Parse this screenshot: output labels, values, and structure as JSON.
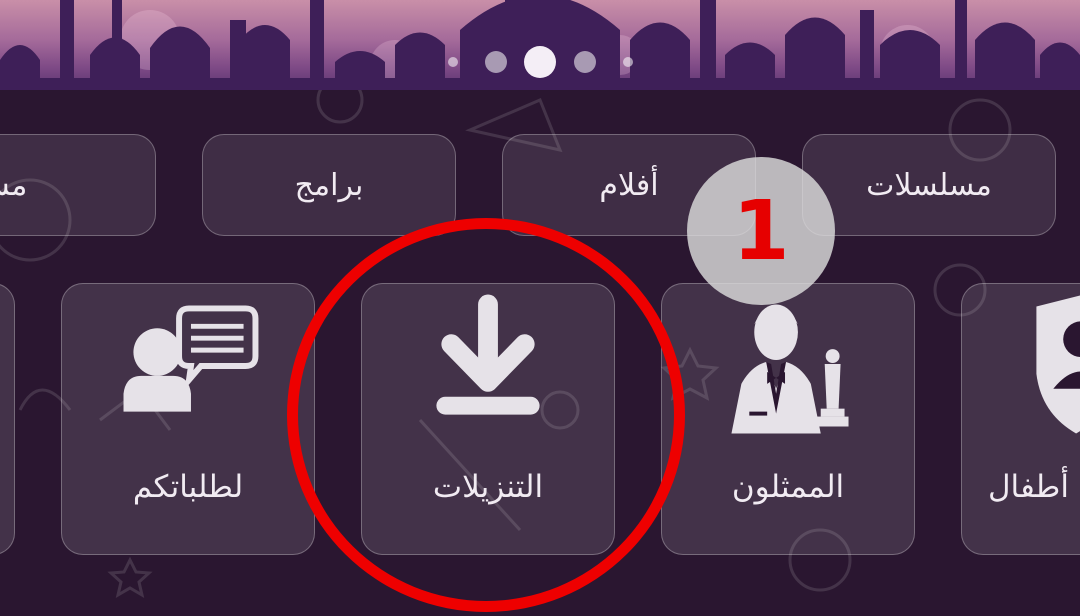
{
  "banner": {
    "carousel": {
      "count": 5,
      "active_index": 2
    }
  },
  "categories": [
    {
      "label": "مسلسلات"
    },
    {
      "label": "أفلام"
    },
    {
      "label": "برامج"
    },
    {
      "label": "مسرحيات"
    }
  ],
  "tiles": [
    {
      "label": "أطفال",
      "icon": "kids-shield-icon"
    },
    {
      "label": "الممثلون",
      "icon": "actor-oscar-icon"
    },
    {
      "label": "التنزيلات",
      "icon": "download-icon"
    },
    {
      "label": "لطلباتكم",
      "icon": "user-speech-bubble-icon"
    }
  ],
  "annotation": {
    "step_number": "1",
    "highlight_color": "#ee0000"
  },
  "colors": {
    "background": "#2a1630",
    "tile_text": "#f1ebf2"
  }
}
